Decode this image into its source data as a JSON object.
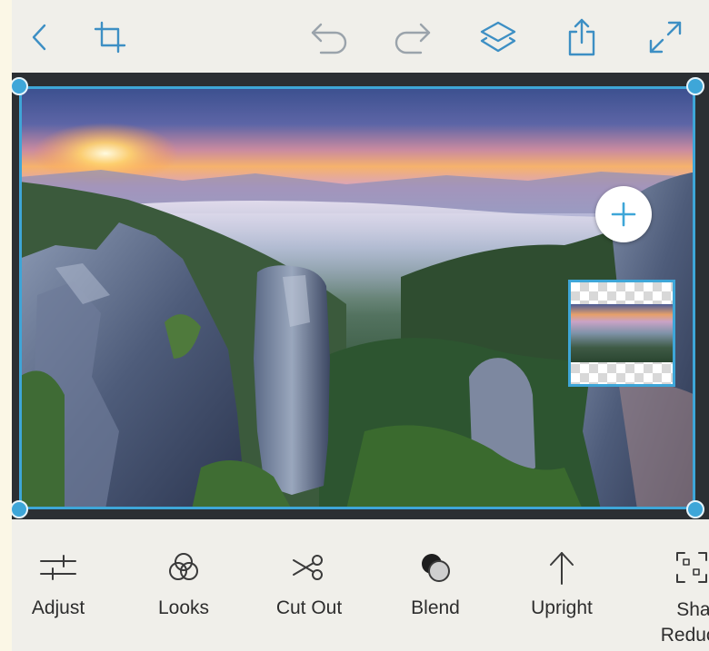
{
  "toolbar": {
    "back": "back-icon",
    "crop": "crop-icon",
    "undo": "undo-icon",
    "redo": "redo-icon",
    "layers": "layers-icon",
    "share": "share-icon",
    "fullscreen": "expand-icon"
  },
  "colors": {
    "accent": "#3ea6d8",
    "toolbar_icon": "#3d8fc4",
    "disabled_icon": "#9aa3ab",
    "background": "#f0efea",
    "canvas": "#2b2f33"
  },
  "tools": [
    {
      "label": "Adjust",
      "icon": "sliders-icon"
    },
    {
      "label": "Looks",
      "icon": "looks-icon"
    },
    {
      "label": "Cut Out",
      "icon": "scissors-icon"
    },
    {
      "label": "Blend",
      "icon": "blend-icon"
    },
    {
      "label": "Upright",
      "icon": "upright-icon"
    },
    {
      "label": "Shake Reduction",
      "icon": "shake-reduction-icon"
    }
  ]
}
